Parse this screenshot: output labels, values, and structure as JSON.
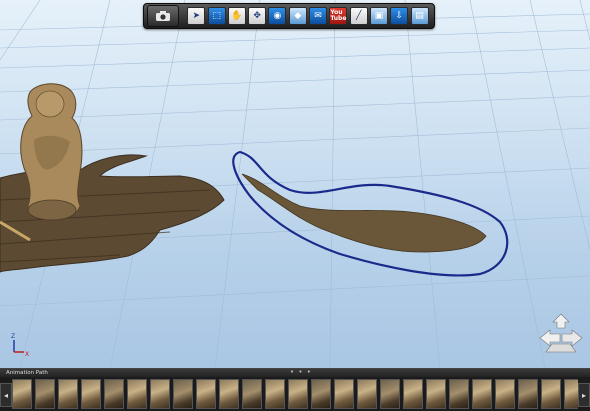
{
  "toolbar": {
    "buttons": [
      {
        "id": "camera",
        "icon": "camera-icon"
      },
      {
        "id": "select",
        "icon": "arrow-cursor-icon"
      },
      {
        "id": "select-region",
        "icon": "region-select-icon",
        "active": true
      },
      {
        "id": "pan",
        "icon": "hand-icon"
      },
      {
        "id": "move",
        "icon": "move-arrows-icon"
      },
      {
        "id": "snapshot",
        "icon": "photo-camera-icon"
      },
      {
        "id": "diamond",
        "icon": "diamond-icon"
      },
      {
        "id": "email",
        "icon": "mail-icon"
      },
      {
        "id": "youtube",
        "icon": "youtube-icon",
        "label": "You Tube"
      },
      {
        "id": "measure",
        "icon": "ruler-icon"
      },
      {
        "id": "view",
        "icon": "window-view-icon"
      },
      {
        "id": "export",
        "icon": "export-icon"
      },
      {
        "id": "settings",
        "icon": "settings-page-icon"
      }
    ]
  },
  "filmstrip": {
    "label": "Animation Path",
    "grip": "• • •",
    "prev_arrow": "◂",
    "next_arrow": "▸",
    "frame_count": 30
  },
  "nav_cube": {
    "icon": "navigation-cube-icon"
  },
  "axis": {
    "x_label": "X",
    "z_label": "Z"
  },
  "colors": {
    "selection_outline": "#1a2a8a",
    "wood": "#5d4a33",
    "statue": "#a88a5c"
  }
}
